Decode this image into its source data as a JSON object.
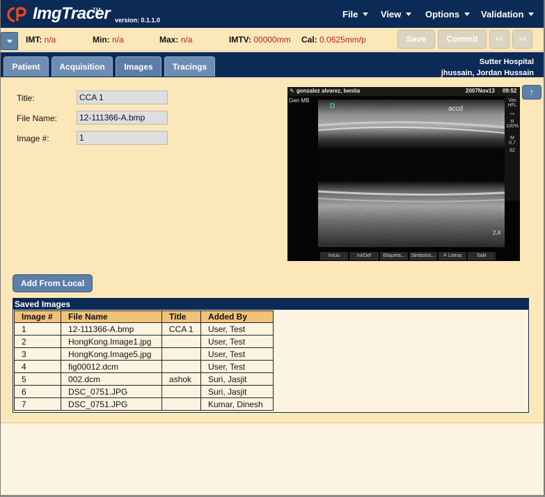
{
  "app": {
    "name": "ImgTracer",
    "tm": "TM",
    "version": "version: 0.1.1.0"
  },
  "menu": [
    {
      "label": "File"
    },
    {
      "label": "View"
    },
    {
      "label": "Options"
    },
    {
      "label": "Validation"
    }
  ],
  "infobar": {
    "imt_label": "IMT:",
    "imt_value": "n/a",
    "min_label": "Min:",
    "min_value": "n/a",
    "max_label": "Max:",
    "max_value": "n/a",
    "imtv_label": "IMTV:",
    "imtv_value": "00000mm",
    "cal_label": "Cal:",
    "cal_value": "0.0625mm/p",
    "save_label": "Save",
    "commit_label": "Commit",
    "prev_label": "<<",
    "next_label": ">>"
  },
  "tabs": [
    {
      "label": "Patient"
    },
    {
      "label": "Acquisition"
    },
    {
      "label": "Images"
    },
    {
      "label": "Tracings"
    }
  ],
  "user": {
    "hospital": "Sutter Hospital",
    "name": "jhussain, Jordan Hussain"
  },
  "form": {
    "title_label": "Title:",
    "title_value": "CCA 1",
    "filename_label": "File Name:",
    "filename_value": "12-111366-A.bmp",
    "imagenum_label": "Image #:",
    "imagenum_value": "1"
  },
  "ultrasound": {
    "patient": "gonzalez alvarez, benita",
    "date": "2007Nov13",
    "time": "09:52",
    "mode": "Gen MB",
    "annotation": "accd",
    "side": [
      "Vas",
      "HFL",
      "100%",
      "M",
      "0,7",
      "82"
    ],
    "depth": "2,4",
    "buttons": [
      "Inicio",
      "Ini/Def",
      "Etiqueta...",
      "Simbolos...",
      "Letras",
      "Salir"
    ]
  },
  "add_button": "Add From Local",
  "saved_images": {
    "title": "Saved Images",
    "columns": [
      "Image #",
      "File Name",
      "Title",
      "Added By"
    ],
    "rows": [
      [
        "1",
        "12-111366-A.bmp",
        "CCA 1",
        "User, Test"
      ],
      [
        "2",
        "HongKong.Image1.jpg",
        "",
        "User, Test"
      ],
      [
        "3",
        "HongKong.Image5.jpg",
        "",
        "User, Test"
      ],
      [
        "4",
        "fig00012.dcm",
        "",
        "User, Test"
      ],
      [
        "5",
        "002.dcm",
        "ashok",
        "Suri, Jasjit"
      ],
      [
        "6",
        "DSC_0751.JPG",
        "",
        "Suri, Jasjit"
      ],
      [
        "7",
        "DSC_0751.JPG",
        "",
        "Kumar, Dinesh"
      ]
    ]
  },
  "colors": {
    "header_bg": "#0b2a55",
    "panel_bg": "#fbe7b8",
    "value_red": "#c0201a",
    "button_blue": "#5e7fa6",
    "table_header": "#f0c27a"
  }
}
